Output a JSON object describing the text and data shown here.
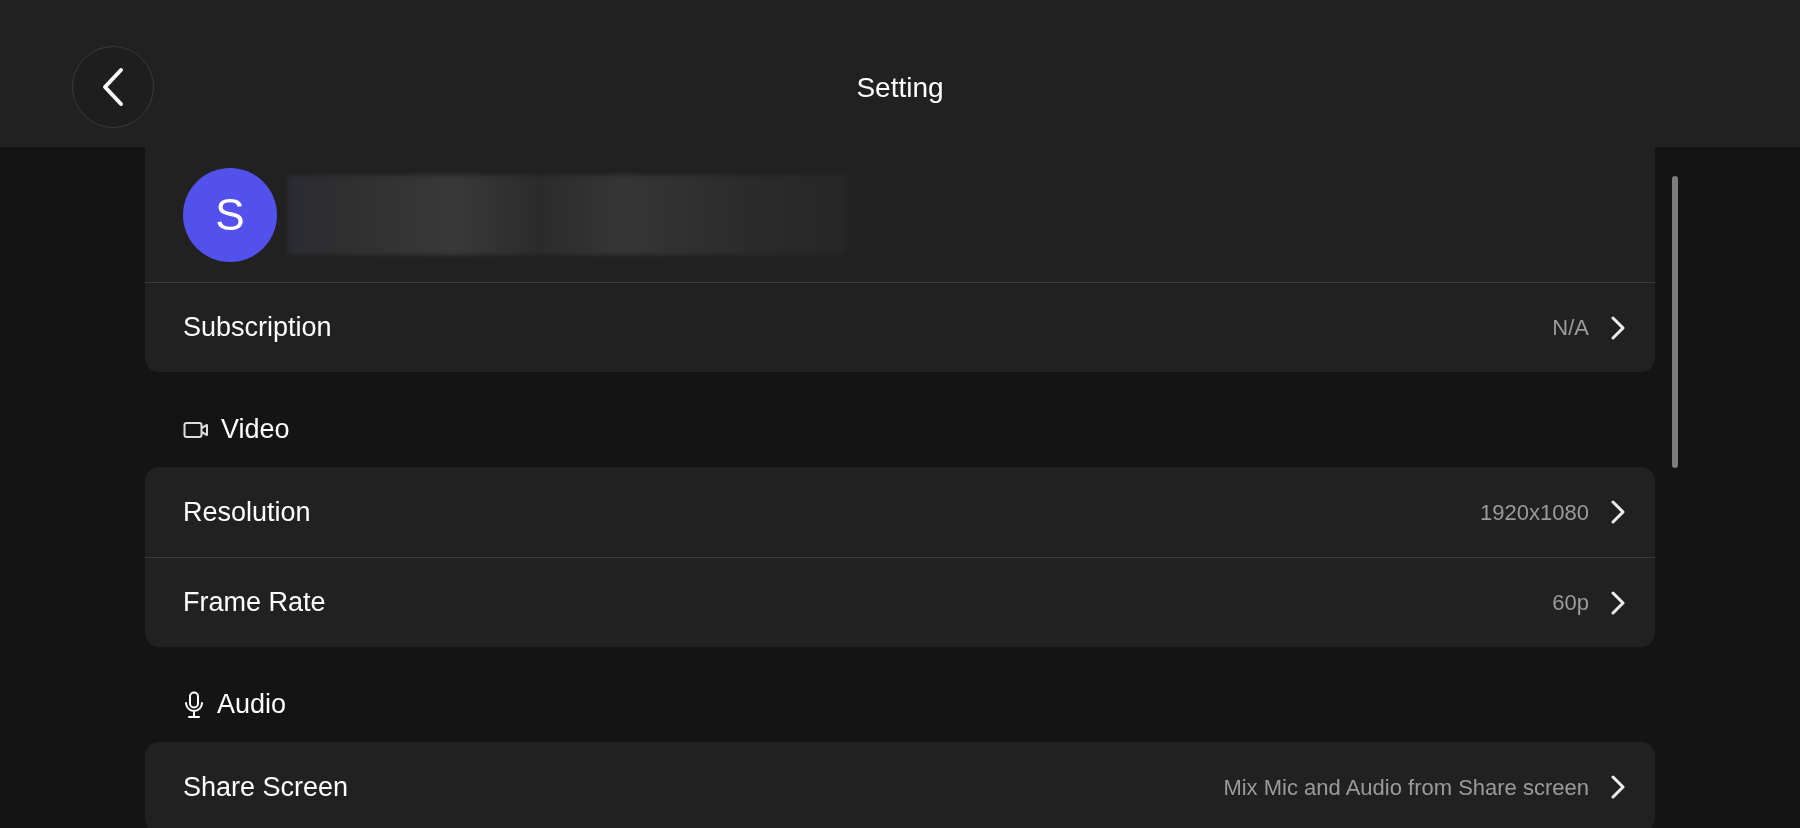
{
  "header": {
    "title": "Setting"
  },
  "account": {
    "avatar_initial": "S",
    "rows": [
      {
        "label": "Subscription",
        "value": "N/A"
      }
    ]
  },
  "sections": [
    {
      "title": "Video",
      "kind": "video",
      "rows": [
        {
          "label": "Resolution",
          "value": "1920x1080"
        },
        {
          "label": "Frame Rate",
          "value": "60p"
        }
      ]
    },
    {
      "title": "Audio",
      "kind": "mic",
      "rows": [
        {
          "label": "Share Screen",
          "value": "Mix Mic and Audio from Share screen"
        }
      ]
    }
  ]
}
